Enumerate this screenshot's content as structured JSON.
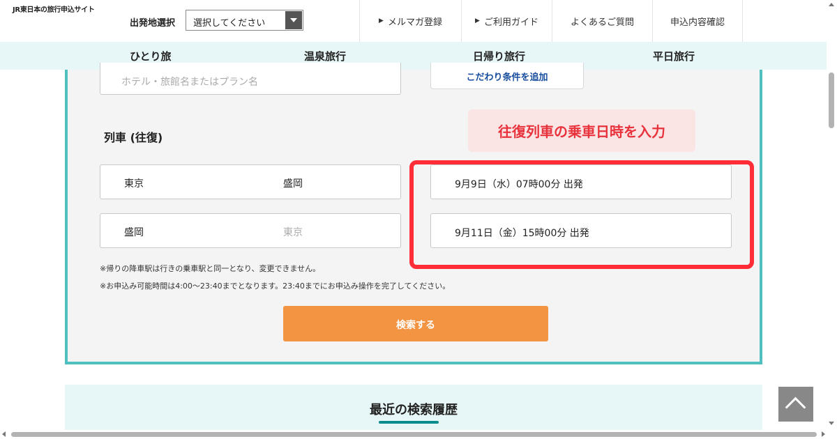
{
  "header": {
    "logo": "JR東日本の旅行申込サイト",
    "departure_label": "出発地選択",
    "departure_select": "選択してください",
    "links": [
      "メルマガ登録",
      "ご利用ガイド",
      "よくあるご質問",
      "申込内容確認"
    ],
    "link_arrow": "▶"
  },
  "nav": {
    "categories": [
      "ひとり旅",
      "温泉旅行",
      "日帰り旅行",
      "平日旅行"
    ]
  },
  "search": {
    "hotel_placeholder": "ホテル・旅館名またはプラン名",
    "condition_button": "こだわり条件を追加",
    "train_title": "列車 (往復)",
    "callout": "往復列車の乗車日時を入力",
    "outbound": {
      "from": "東京",
      "to": "盛岡",
      "datetime": "9月9日（水）07時00分 出発"
    },
    "return": {
      "from": "盛岡",
      "to": "東京",
      "datetime": "9月11日（金）15時00分 出発"
    },
    "notes": [
      "※帰りの降車駅は行きの乗車駅と同一となり、変更できません。",
      "※お申込み可能時間は4:00〜23:40までとなります。23:40までにお申込み操作を完了してください。"
    ],
    "submit": "検索する"
  },
  "history": {
    "title": "最近の検索履歴"
  },
  "colors": {
    "accent_teal": "#4fbfc0",
    "highlight_red": "#ff2d37",
    "button_orange": "#f39443",
    "nav_bg": "#e7f6f6"
  }
}
